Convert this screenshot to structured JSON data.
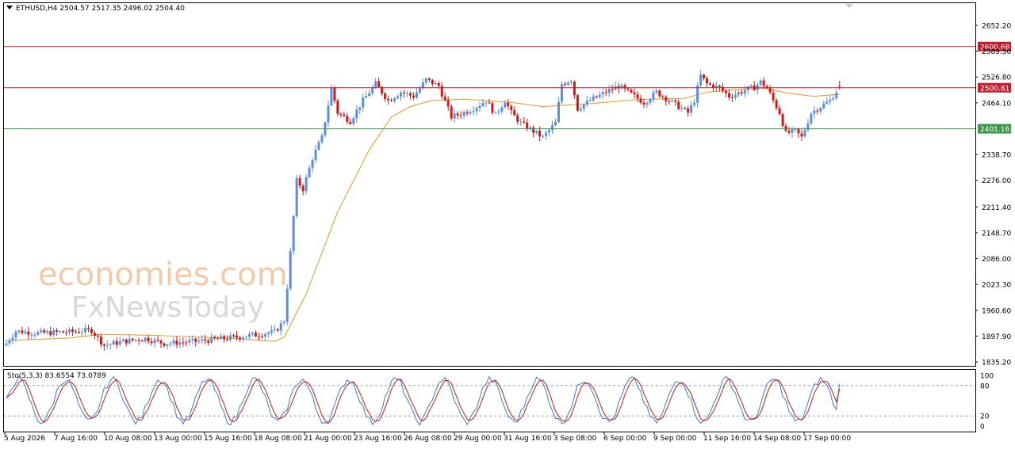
{
  "header": {
    "symbol": "ETHUSD,H4",
    "open": "2504.57",
    "high": "2517.35",
    "low": "2496.02",
    "close": "2504.40"
  },
  "watermark": {
    "line1": "economies.com",
    "line2": "FxNewsToday"
  },
  "colors": {
    "bull": "#5a8ee0",
    "bear": "#d01818",
    "ma": "#e8961e",
    "resistance": "#c81e2d",
    "support": "#3a9a4a",
    "stoch_k": "#3a7adf",
    "stoch_d": "#d01818"
  },
  "chart_data": {
    "type": "candlestick",
    "timeframe": "H4",
    "ylim": [
      1835.2,
      2680
    ],
    "yticks": [
      "2652.20",
      "2589.50",
      "2526.80",
      "2464.10",
      "2338.70",
      "2276.00",
      "2211.40",
      "2148.70",
      "2086.00",
      "2023.30",
      "1960.60",
      "1897.90",
      "1835.20"
    ],
    "xticks": [
      "5 Aug 2026",
      "7 Aug 16:00",
      "10 Aug 08:00",
      "13 Aug 00:00",
      "15 Aug 16:00",
      "18 Aug 08:00",
      "21 Aug 00:00",
      "23 Aug 16:00",
      "26 Aug 08:00",
      "29 Aug 00:00",
      "31 Aug 16:00",
      "3 Sep 08:00",
      "6 Sep 00:00",
      "9 Sep 00:00",
      "11 Sep 16:00",
      "14 Sep 08:00",
      "17 Sep 00:00"
    ],
    "price_levels": [
      {
        "label": "2600.68",
        "value": 2600.68,
        "color": "#c81e2d"
      },
      {
        "label": "2500.81",
        "value": 2500.81,
        "color": "#c81e2d"
      },
      {
        "label": "2401.16",
        "value": 2401.16,
        "color": "#3a9a4a"
      }
    ],
    "close_anchors": [
      [
        0,
        1880
      ],
      [
        3,
        1910
      ],
      [
        10,
        1905
      ],
      [
        20,
        1908
      ],
      [
        27,
        1912
      ],
      [
        31,
        1875
      ],
      [
        37,
        1885
      ],
      [
        44,
        1892
      ],
      [
        50,
        1880
      ],
      [
        60,
        1885
      ],
      [
        70,
        1893
      ],
      [
        78,
        1900
      ],
      [
        85,
        1908
      ],
      [
        88,
        1935
      ],
      [
        90,
        2100
      ],
      [
        92,
        2275
      ],
      [
        94,
        2255
      ],
      [
        97,
        2330
      ],
      [
        100,
        2380
      ],
      [
        103,
        2500
      ],
      [
        105,
        2440
      ],
      [
        109,
        2420
      ],
      [
        113,
        2470
      ],
      [
        117,
        2510
      ],
      [
        121,
        2470
      ],
      [
        125,
        2490
      ],
      [
        129,
        2480
      ],
      [
        133,
        2520
      ],
      [
        137,
        2505
      ],
      [
        141,
        2430
      ],
      [
        145,
        2440
      ],
      [
        149,
        2455
      ],
      [
        152,
        2470
      ],
      [
        155,
        2435
      ],
      [
        158,
        2470
      ],
      [
        160,
        2440
      ],
      [
        163,
        2415
      ],
      [
        167,
        2395
      ],
      [
        170,
        2380
      ],
      [
        174,
        2415
      ],
      [
        176,
        2510
      ],
      [
        179,
        2520
      ],
      [
        181,
        2450
      ],
      [
        185,
        2470
      ],
      [
        190,
        2490
      ],
      [
        194,
        2505
      ],
      [
        198,
        2485
      ],
      [
        202,
        2465
      ],
      [
        206,
        2490
      ],
      [
        210,
        2470
      ],
      [
        213,
        2455
      ],
      [
        216,
        2440
      ],
      [
        218,
        2470
      ],
      [
        220,
        2530
      ],
      [
        222,
        2510
      ],
      [
        226,
        2500
      ],
      [
        229,
        2480
      ],
      [
        231,
        2485
      ],
      [
        234,
        2495
      ],
      [
        237,
        2502
      ],
      [
        239,
        2515
      ],
      [
        241,
        2500
      ],
      [
        243,
        2470
      ],
      [
        245,
        2440
      ],
      [
        247,
        2390
      ],
      [
        250,
        2395
      ],
      [
        252,
        2380
      ],
      [
        255,
        2440
      ],
      [
        258,
        2455
      ],
      [
        261,
        2470
      ],
      [
        264,
        2504
      ]
    ],
    "ma_anchors": [
      [
        0,
        1887
      ],
      [
        20,
        1893
      ],
      [
        30,
        1902
      ],
      [
        45,
        1900
      ],
      [
        70,
        1893
      ],
      [
        85,
        1885
      ],
      [
        88,
        1895
      ],
      [
        95,
        2000
      ],
      [
        105,
        2200
      ],
      [
        115,
        2350
      ],
      [
        122,
        2430
      ],
      [
        128,
        2455
      ],
      [
        135,
        2470
      ],
      [
        145,
        2473
      ],
      [
        160,
        2465
      ],
      [
        170,
        2455
      ],
      [
        185,
        2462
      ],
      [
        200,
        2472
      ],
      [
        215,
        2475
      ],
      [
        222,
        2490
      ],
      [
        230,
        2495
      ],
      [
        240,
        2500
      ],
      [
        248,
        2487
      ],
      [
        256,
        2480
      ],
      [
        264,
        2485
      ]
    ],
    "stochastic": {
      "label": "Sto(5,3,3)",
      "k": 83.6554,
      "d": 73.0789,
      "ylim": [
        0,
        100
      ],
      "levels": [
        80,
        20
      ],
      "yticks": [
        "100",
        "80",
        "20",
        "0"
      ]
    }
  }
}
